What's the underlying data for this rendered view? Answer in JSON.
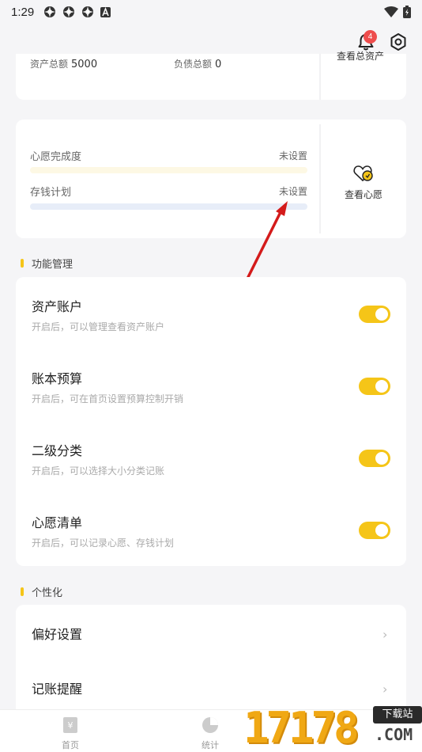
{
  "status_bar": {
    "time": "1:29",
    "notification_icons": [
      "settings-gear-notif-icon",
      "settings-gear-notif-icon",
      "settings-gear-notif-icon",
      "a-letter-notif-icon"
    ],
    "right_icons": [
      "wifi-icon",
      "battery-icon"
    ]
  },
  "header": {
    "notification_count": "4"
  },
  "asset_summary": {
    "total_assets_label": "资产总额",
    "total_assets_value": "5000",
    "total_liabilities_label": "负债总额",
    "total_liabilities_value": "0",
    "view_total_label": "查看总资产"
  },
  "wish_card": {
    "completion_label": "心愿完成度",
    "completion_value": "未设置",
    "savings_label": "存钱计划",
    "savings_value": "未设置",
    "view_wishes_label": "查看心愿"
  },
  "features_section": {
    "title": "功能管理",
    "items": [
      {
        "title": "资产账户",
        "desc": "开启后，可以管理查看资产账户",
        "enabled": true
      },
      {
        "title": "账本预算",
        "desc": "开启后，可在首页设置预算控制开销",
        "enabled": true
      },
      {
        "title": "二级分类",
        "desc": "开启后，可以选择大小分类记账",
        "enabled": true
      },
      {
        "title": "心愿清单",
        "desc": "开启后，可以记录心愿、存钱计划",
        "enabled": true
      }
    ]
  },
  "personalization_section": {
    "title": "个性化",
    "items": [
      {
        "label": "偏好设置"
      },
      {
        "label": "记账提醒"
      }
    ]
  },
  "bottom_nav": {
    "home_label": "首页",
    "stats_label": "统计"
  },
  "watermark": {
    "digits": "17178",
    "tag": "下载站",
    "suffix": ".COM"
  },
  "colors": {
    "accent": "#f5c518",
    "badge": "#ee4d4d",
    "background": "#f5f5f7",
    "arrow": "#d41b1b"
  }
}
